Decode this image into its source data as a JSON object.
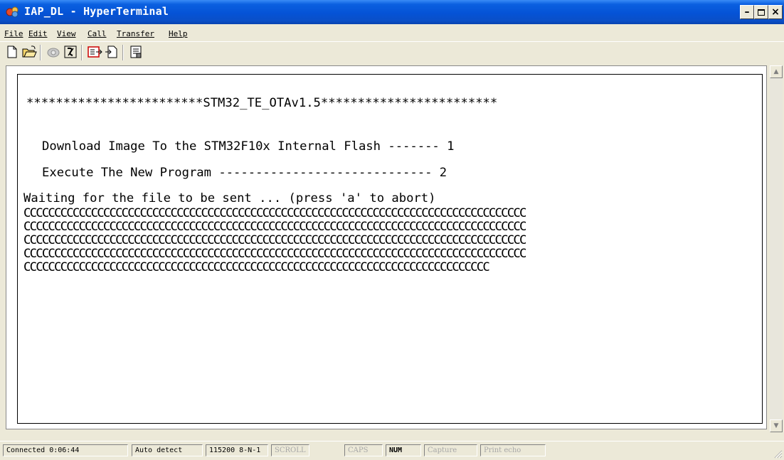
{
  "window": {
    "title": "IAP_DL - HyperTerminal"
  },
  "menu": {
    "items": [
      "File",
      "Edit",
      "View",
      "Call",
      "Transfer",
      "Help"
    ]
  },
  "toolbar": {
    "icons": [
      "new-connection-icon",
      "open-icon",
      "dial-icon",
      "disconnect-icon",
      "send-icon",
      "receive-icon",
      "properties-icon"
    ]
  },
  "terminal": {
    "header": "************************STM32_TE_OTAv1.5************************",
    "option1": "Download Image To the STM32F10x Internal Flash ------- 1",
    "option2": "Execute The New Program ----------------------------- 2",
    "waiting": "Waiting for the file to be sent ... (press 'a' to abort)",
    "c_lines": [
      "CCCCCCCCCCCCCCCCCCCCCCCCCCCCCCCCCCCCCCCCCCCCCCCCCCCCCCCCCCCCCCCCCCCCCCCCCCCCCCCCCC",
      "CCCCCCCCCCCCCCCCCCCCCCCCCCCCCCCCCCCCCCCCCCCCCCCCCCCCCCCCCCCCCCCCCCCCCCCCCCCCCCCCCC",
      "CCCCCCCCCCCCCCCCCCCCCCCCCCCCCCCCCCCCCCCCCCCCCCCCCCCCCCCCCCCCCCCCCCCCCCCCCCCCCCCCCC",
      "CCCCCCCCCCCCCCCCCCCCCCCCCCCCCCCCCCCCCCCCCCCCCCCCCCCCCCCCCCCCCCCCCCCCCCCCCCCCCCCCCC",
      "CCCCCCCCCCCCCCCCCCCCCCCCCCCCCCCCCCCCCCCCCCCCCCCCCCCCCCCCCCCCCCCCCCCCCCCCCCCC"
    ]
  },
  "status": {
    "connected": "Connected 0:06:44",
    "detect": "Auto detect",
    "settings": "115200 8-N-1",
    "scroll": "SCROLL",
    "caps": "CAPS",
    "num": "NUM",
    "capture": "Capture",
    "print_echo": "Print echo"
  },
  "colors": {
    "titlebar": "#0553d6",
    "chrome": "#ece9d8",
    "terminal_bg": "#ffffff",
    "terminal_fg": "#000000"
  }
}
